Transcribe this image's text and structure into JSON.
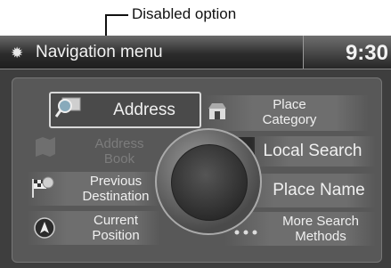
{
  "annotation": {
    "label": "Disabled option"
  },
  "titlebar": {
    "title": "Navigation menu",
    "time": "9:30",
    "icon": "gear-icon"
  },
  "menu": {
    "address": "Address",
    "address_book": "Address\nBook",
    "previous_destination": "Previous\nDestination",
    "current_position": "Current\nPosition",
    "place_category": "Place\nCategory",
    "local_search": "Local Search",
    "place_name": "Place Name",
    "more_search_methods": "More Search\nMethods"
  }
}
